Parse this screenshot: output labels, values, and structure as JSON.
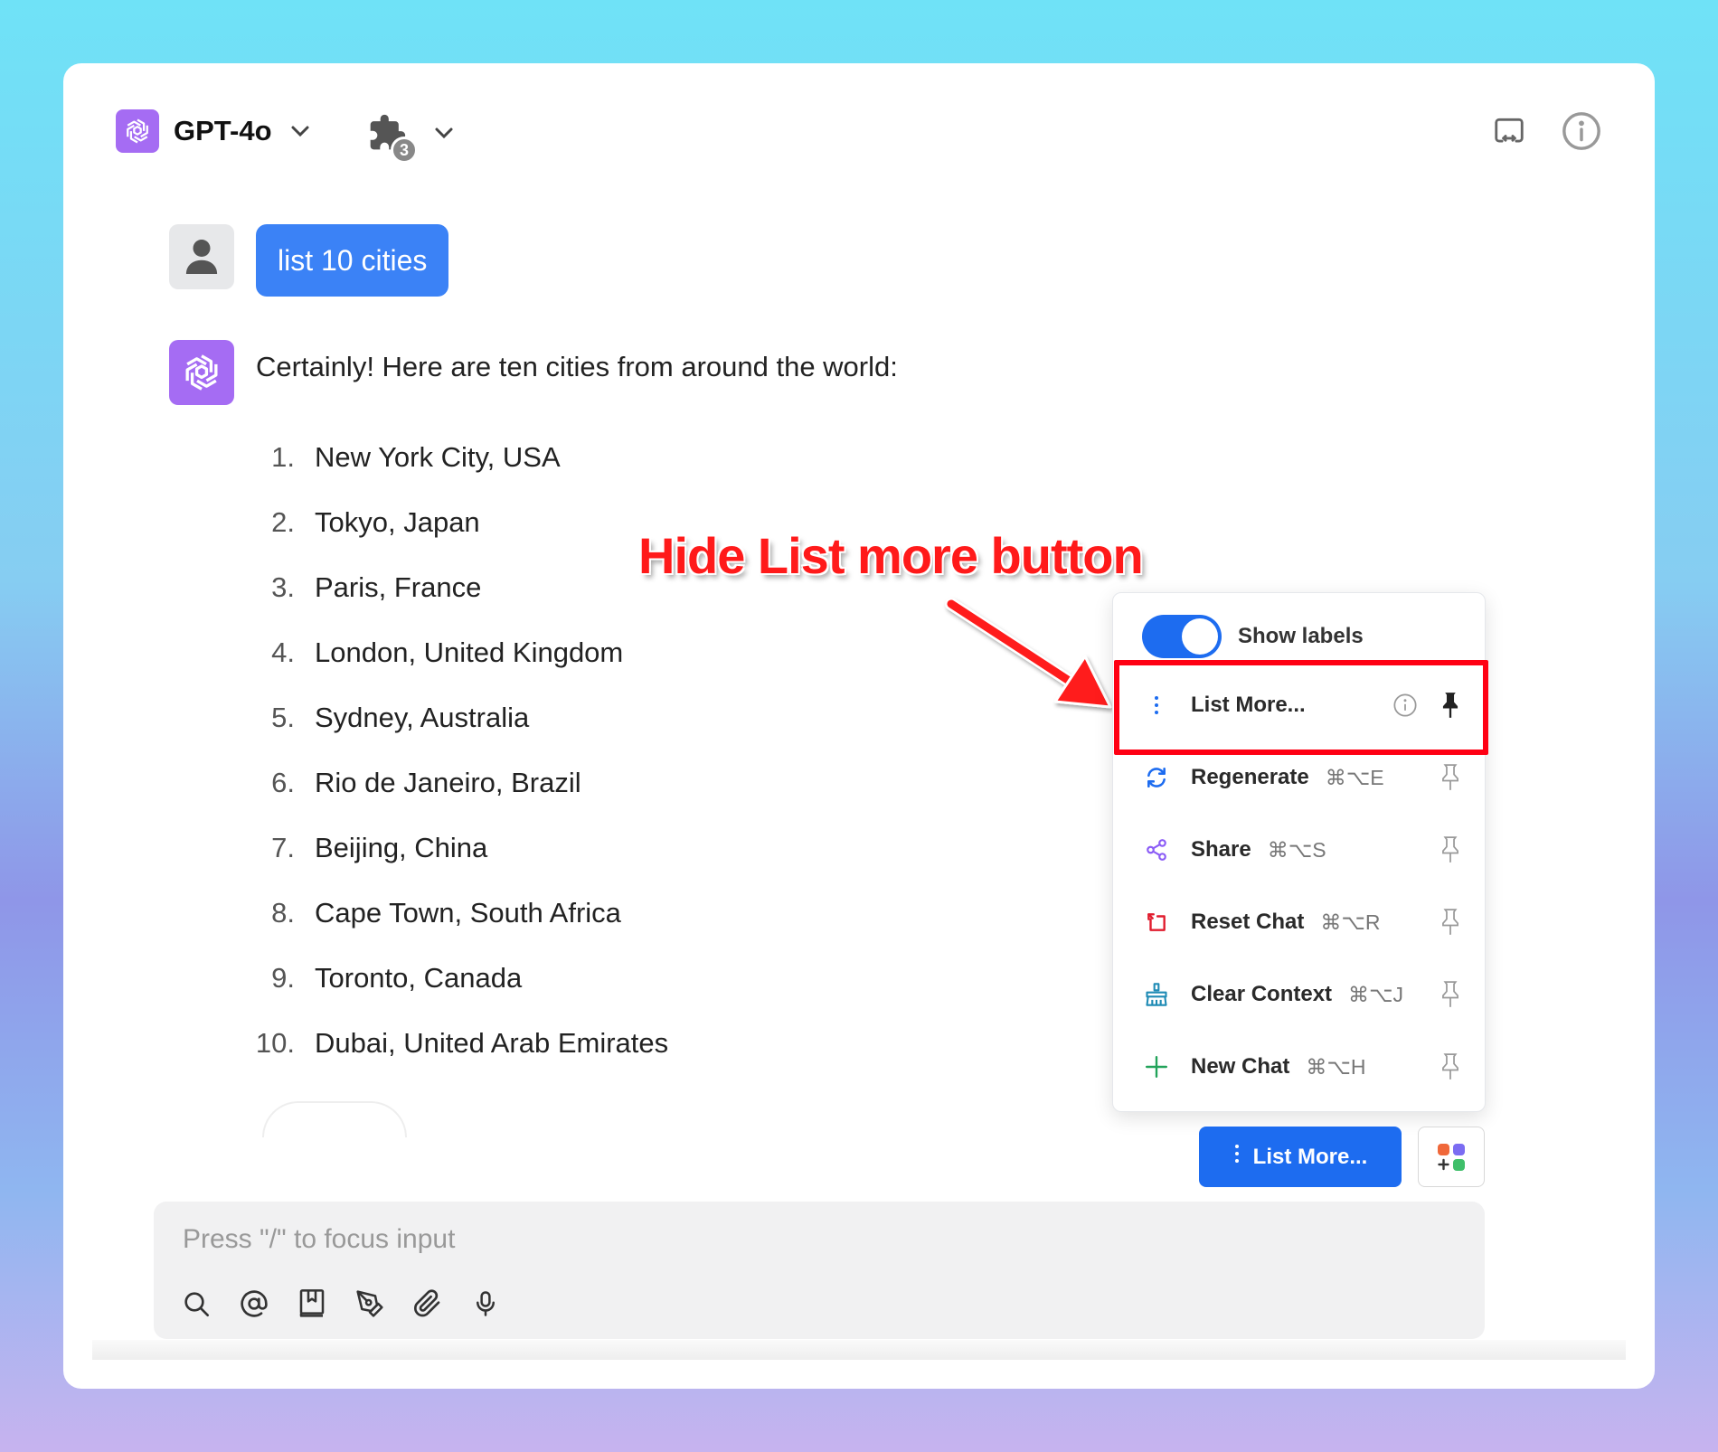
{
  "header": {
    "model_name": "GPT-4o",
    "plugin_count": "3"
  },
  "messages": {
    "user_text": "list 10 cities",
    "assistant_intro": "Certainly! Here are ten cities from around the world:",
    "cities": [
      {
        "num": "1.",
        "name": "New York City, USA"
      },
      {
        "num": "2.",
        "name": "Tokyo, Japan"
      },
      {
        "num": "3.",
        "name": "Paris, France"
      },
      {
        "num": "4.",
        "name": "London, United Kingdom"
      },
      {
        "num": "5.",
        "name": "Sydney, Australia"
      },
      {
        "num": "6.",
        "name": "Rio de Janeiro, Brazil"
      },
      {
        "num": "7.",
        "name": "Beijing, China"
      },
      {
        "num": "8.",
        "name": "Cape Town, South Africa"
      },
      {
        "num": "9.",
        "name": "Toronto, Canada"
      },
      {
        "num": "10.",
        "name": "Dubai, United Arab Emirates"
      }
    ]
  },
  "annotation": {
    "text": "Hide List more button"
  },
  "menu": {
    "toggle_label": "Show labels",
    "toggle_on": true,
    "items": [
      {
        "label": "List More...",
        "shortcut": "",
        "pinned": true,
        "icon": "vertical-dots-icon"
      },
      {
        "label": "Regenerate",
        "shortcut": "⌘⌥E",
        "pinned": false,
        "icon": "regenerate-icon"
      },
      {
        "label": "Share",
        "shortcut": "⌘⌥S",
        "pinned": false,
        "icon": "share-icon"
      },
      {
        "label": "Reset Chat",
        "shortcut": "⌘⌥R",
        "pinned": false,
        "icon": "reset-icon"
      },
      {
        "label": "Clear Context",
        "shortcut": "⌘⌥J",
        "pinned": false,
        "icon": "broom-icon"
      },
      {
        "label": "New Chat",
        "shortcut": "⌘⌥H",
        "pinned": false,
        "icon": "plus-icon"
      }
    ]
  },
  "actions": {
    "list_more_label": "List More..."
  },
  "input": {
    "placeholder": "Press \"/\" to focus input"
  },
  "colors": {
    "accent": "#1d6cf0",
    "model_purple": "#a56cf3",
    "highlight_red": "#ff0013"
  }
}
